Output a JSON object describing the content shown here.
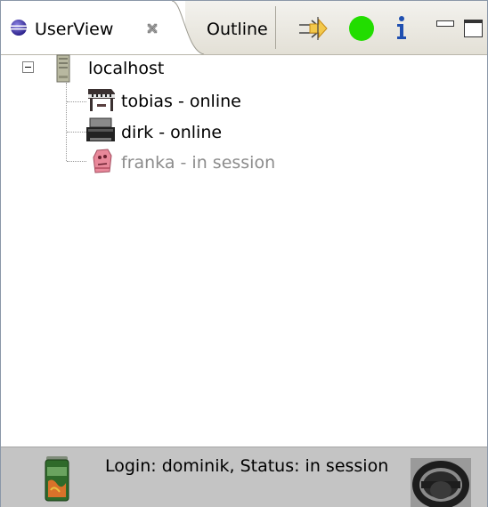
{
  "tabs": {
    "userview_label": "UserView",
    "outline_label": "Outline"
  },
  "toolbar": {
    "icons": [
      "connect-arrow-icon",
      "status-online-icon",
      "info-icon",
      "minimize-icon",
      "maximize-icon"
    ],
    "status_color": "#22dd00"
  },
  "tree": {
    "root": {
      "label": "localhost",
      "icon": "server-icon"
    },
    "users": [
      {
        "label": "tobias - online",
        "icon": "piano-icon",
        "state": "online"
      },
      {
        "label": "dirk - online",
        "icon": "printer-icon",
        "state": "online"
      },
      {
        "label": "franka - in session",
        "icon": "figure-icon",
        "state": "in session"
      }
    ]
  },
  "statusbar": {
    "text": "Login: dominik, Status: in session",
    "left_icon": "can-icon",
    "right_icon": "steering-wheel-icon"
  }
}
